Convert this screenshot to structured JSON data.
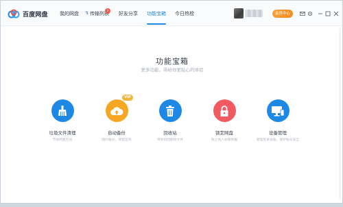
{
  "app": {
    "logo_text": "百度网盘"
  },
  "nav": {
    "items": [
      {
        "label": "我的网盘"
      },
      {
        "label": "传输列表",
        "badge": "3"
      },
      {
        "label": "好友分享"
      },
      {
        "label": "功能宝箱",
        "active": true
      },
      {
        "label": "今日热榜"
      }
    ]
  },
  "topbar": {
    "member_button": "会员中心"
  },
  "page": {
    "title": "功能宝箱",
    "subtitle": "更多功能，带给你更贴心的体验"
  },
  "tools": [
    {
      "name": "垃圾文件清理",
      "desc": "节省网盘空间",
      "icon": "broom-icon",
      "color": "#1e88e5"
    },
    {
      "name": "自动备份",
      "desc": "随时备份，保留签到",
      "icon": "cloud-upload-icon",
      "color": "#f5a623",
      "badge": "VIP"
    },
    {
      "name": "回收站",
      "desc": "带你找回删除文件",
      "icon": "trash-icon",
      "color": "#1e88e5"
    },
    {
      "name": "锁定网盘",
      "desc": "防止他人偷看数据",
      "icon": "lock-icon",
      "color": "#f05a60"
    },
    {
      "name": "设备管理",
      "desc": "管理登录设备，保护账号安全",
      "icon": "monitor-icon",
      "color": "#1e88e5"
    }
  ]
}
